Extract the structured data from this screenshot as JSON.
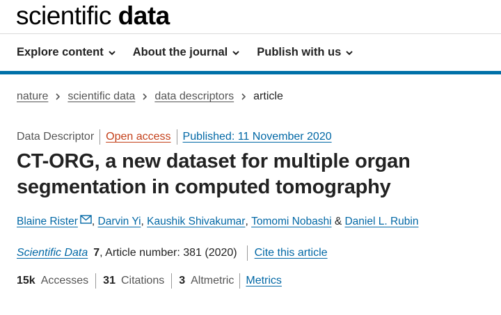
{
  "logo": {
    "light": "scientific",
    "bold": "data"
  },
  "nav": {
    "items": [
      {
        "label": "Explore content"
      },
      {
        "label": "About the journal"
      },
      {
        "label": "Publish with us"
      }
    ]
  },
  "breadcrumb": {
    "items": [
      "nature",
      "scientific data",
      "data descriptors"
    ],
    "current": "article"
  },
  "meta": {
    "type": "Data Descriptor",
    "access": "Open access",
    "published": "Published: 11 November 2020"
  },
  "article": {
    "title": "CT-ORG, a new dataset for multiple organ segmentation in computed tomography",
    "authors": [
      "Blaine Rister",
      "Darvin Yi",
      "Kaushik Shivakumar",
      "Tomomi Nobashi",
      "Daniel L. Rubin"
    ],
    "author_separator": ",",
    "last_separator": "&"
  },
  "citation": {
    "journal": "Scientific Data",
    "volume": "7",
    "details": ", Article number: 381 (2020)",
    "cite_label": "Cite this article"
  },
  "metrics": {
    "accesses_value": "15k",
    "accesses_label": "Accesses",
    "citations_value": "31",
    "citations_label": "Citations",
    "altmetric_value": "3",
    "altmetric_label": "Altmetric",
    "metrics_link": "Metrics"
  },
  "colors": {
    "accent_blue": "#0070a8",
    "link_blue": "#0067a5",
    "open_access": "#c4401a"
  }
}
